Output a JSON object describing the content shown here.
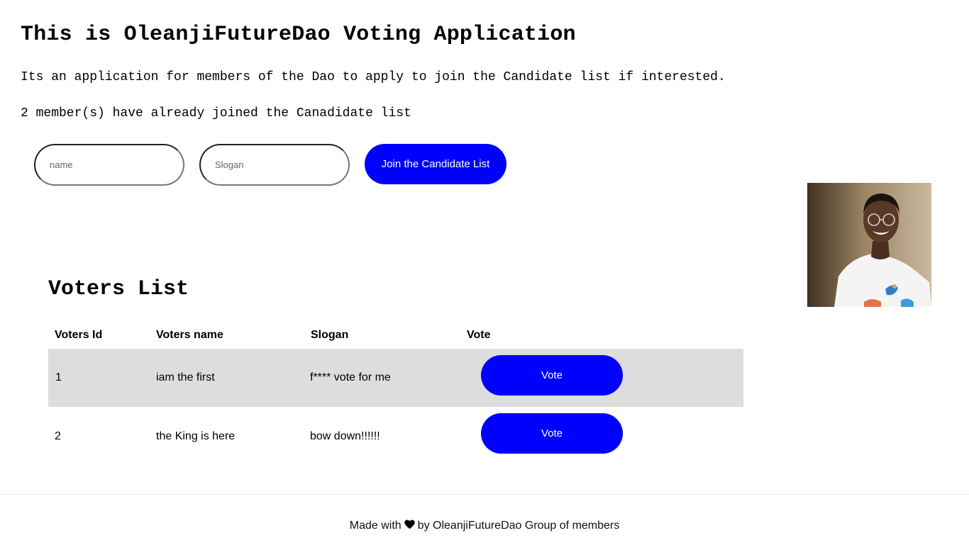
{
  "header": {
    "title": "This is OleanjiFutureDao Voting Application",
    "description": "Its an application for members of the Dao to apply to join the Candidate list if interested.",
    "member_count_text": "2 member(s) have already joined the Canadidate list"
  },
  "form": {
    "name_placeholder": "name",
    "slogan_placeholder": "Slogan",
    "join_button_label": "Join the Candidate List"
  },
  "voters": {
    "title": "Voters List",
    "columns": [
      "Voters Id",
      "Voters name",
      "Slogan",
      "Vote"
    ],
    "rows": [
      {
        "id": "1",
        "name": "iam the first",
        "slogan": "f**** vote for me",
        "vote_label": "Vote"
      },
      {
        "id": "2",
        "name": "the King is here",
        "slogan": "bow down!!!!!!",
        "vote_label": "Vote"
      }
    ]
  },
  "footer": {
    "prefix": "Made with",
    "icon": "heart-icon",
    "suffix": "by OleanjiFutureDao Group of members"
  },
  "colors": {
    "accent": "#0000ff",
    "row_shade": "#dddddd"
  }
}
